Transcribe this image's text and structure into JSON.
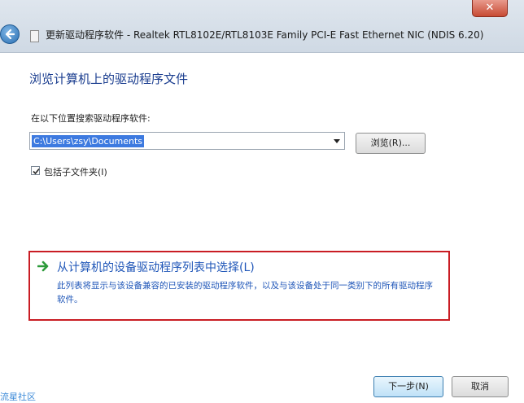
{
  "window": {
    "title": "更新驱动程序软件 - Realtek RTL8102E/RTL8103E Family PCI-E Fast Ethernet NIC (NDIS 6.20)",
    "close_label": "✕"
  },
  "page": {
    "heading": "浏览计算机上的驱动程序文件",
    "search_label": "在以下位置搜索驱动程序软件:",
    "path_value": "C:\\Users\\zsy\\Documents",
    "browse_label": "浏览(R)...",
    "include_subfolders_label": "包括子文件夹(I)",
    "include_subfolders_checked": true
  },
  "option": {
    "title": "从计算机的设备驱动程序列表中选择(L)",
    "description": "此列表将显示与该设备兼容的已安装的驱动程序软件，以及与该设备处于同一类别下的所有驱动程序软件。"
  },
  "footer": {
    "next_label": "下一步(N)",
    "cancel_label": "取消"
  },
  "watermark": {
    "text": "流星社区"
  },
  "colors": {
    "accent_link": "#1f56b8",
    "highlight_border": "#c91d24",
    "selection": "#3d7ae0"
  },
  "icons": {
    "back": "back-arrow-icon",
    "option": "green-arrow-icon",
    "close": "close-icon"
  }
}
